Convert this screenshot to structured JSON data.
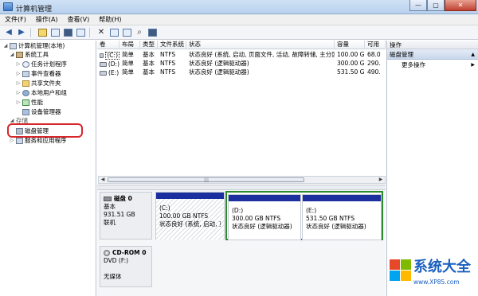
{
  "window": {
    "title": "计算机管理",
    "minimize": "—",
    "maximize": "▢",
    "close": "✕"
  },
  "menu": [
    "文件(F)",
    "操作(A)",
    "查看(V)",
    "帮助(H)"
  ],
  "toolbar_icons": [
    "back-icon",
    "forward-icon",
    "up-folder-icon",
    "show-tree-icon",
    "help-icon",
    "console-icon",
    "delete-icon",
    "properties-icon",
    "disk-icon",
    "search-icon",
    "refresh-icon"
  ],
  "tree": {
    "root": "计算机管理(本地)",
    "system_tools": "系统工具",
    "task_scheduler": "任务计划程序",
    "event_viewer": "事件查看器",
    "shared_folders": "共享文件夹",
    "local_users": "本地用户和组",
    "performance": "性能",
    "device_manager": "设备管理器",
    "storage": "存储",
    "disk_management": "磁盘管理",
    "services_apps": "服务和应用程序"
  },
  "volume_table": {
    "columns": [
      "卷",
      "布局",
      "类型",
      "文件系统",
      "状态",
      "容量",
      "可用"
    ],
    "rows": [
      [
        "(C:)",
        "简单",
        "基本",
        "NTFS",
        "状态良好 (系统, 启动, 页面文件, 活动, 故障转储, 主分区)",
        "100.00 GB",
        "68.0"
      ],
      [
        "(D:)",
        "简单",
        "基本",
        "NTFS",
        "状态良好 (逻辑驱动器)",
        "300.00 GB",
        "290."
      ],
      [
        "(E:)",
        "简单",
        "基本",
        "NTFS",
        "状态良好 (逻辑驱动器)",
        "531.50 GB",
        "490."
      ]
    ]
  },
  "scroll": {
    "left": "◀",
    "right": "▶",
    "grip": "|||"
  },
  "disks": [
    {
      "name": "磁盘 0",
      "type": "基本",
      "size": "931.51 GB",
      "status": "联机"
    },
    {
      "name": "CD-ROM 0",
      "type": "DVD (F:)",
      "size": "",
      "status": "无媒体"
    }
  ],
  "partitions": [
    {
      "name": "(C:)",
      "size": "100.00 GB NTFS",
      "status": "状态良好 (系统, 启动, 页"
    },
    {
      "name": "(D:)",
      "size": "300.00 GB NTFS",
      "status": "状态良好 (逻辑驱动器)"
    },
    {
      "name": "(E:)",
      "size": "531.50 GB NTFS",
      "status": "状态良好 (逻辑驱动器)"
    }
  ],
  "actions": {
    "title": "操作",
    "section": "磁盘管理",
    "section_arrow": "▲",
    "more": "更多操作",
    "more_arrow": "▶"
  },
  "watermark": {
    "text": "系统大全",
    "url": "www.XP85.com"
  },
  "colors": {
    "partition_bar": "#1c2f9e",
    "extended_border": "#2d8a2d",
    "highlight_ring": "#d8262a",
    "brand_blue": "#1a5fc0"
  }
}
